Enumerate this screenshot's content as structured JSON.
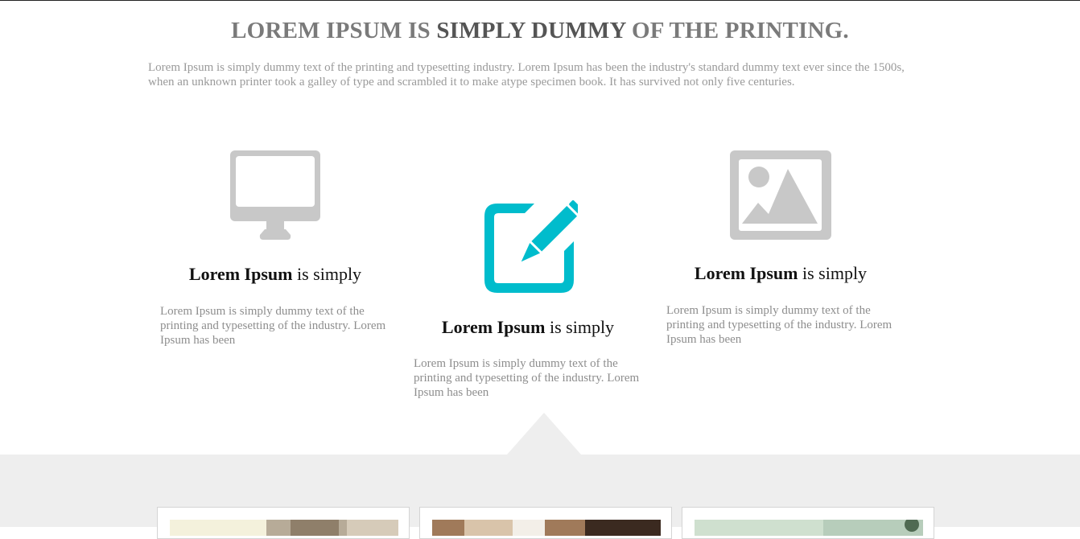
{
  "headline": {
    "part1": "LOREM IPSUM IS ",
    "part2": "SIMPLY DUMMY",
    "part3": " OF THE PRINTING."
  },
  "intro": "Lorem Ipsum is simply dummy text of the printing and typesetting industry. Lorem Ipsum has been the industry's standard dummy text ever since the 1500s, when an unknown printer took a galley of type and scrambled it to make atype specimen book. It has survived not only five centuries.",
  "features": [
    {
      "icon": "monitor-icon",
      "title_bold": "Lorem Ipsum",
      "title_rest": " is simply",
      "desc": "Lorem Ipsum is simply dummy text of the printing and typesetting of the industry. Lorem Ipsum has been"
    },
    {
      "icon": "edit-icon",
      "title_bold": "Lorem Ipsum",
      "title_rest": " is simply",
      "desc": "Lorem Ipsum is simply dummy text of the printing and typesetting of the industry. Lorem Ipsum has been"
    },
    {
      "icon": "image-icon",
      "title_bold": "Lorem Ipsum",
      "title_rest": " is simply",
      "desc": "Lorem Ipsum is simply dummy text of the printing and typesetting of the industry. Lorem Ipsum has been"
    }
  ],
  "colors": {
    "accent": "#00bccc",
    "icon_gray": "#c8c8c8",
    "band_bg": "#eeeeee"
  }
}
